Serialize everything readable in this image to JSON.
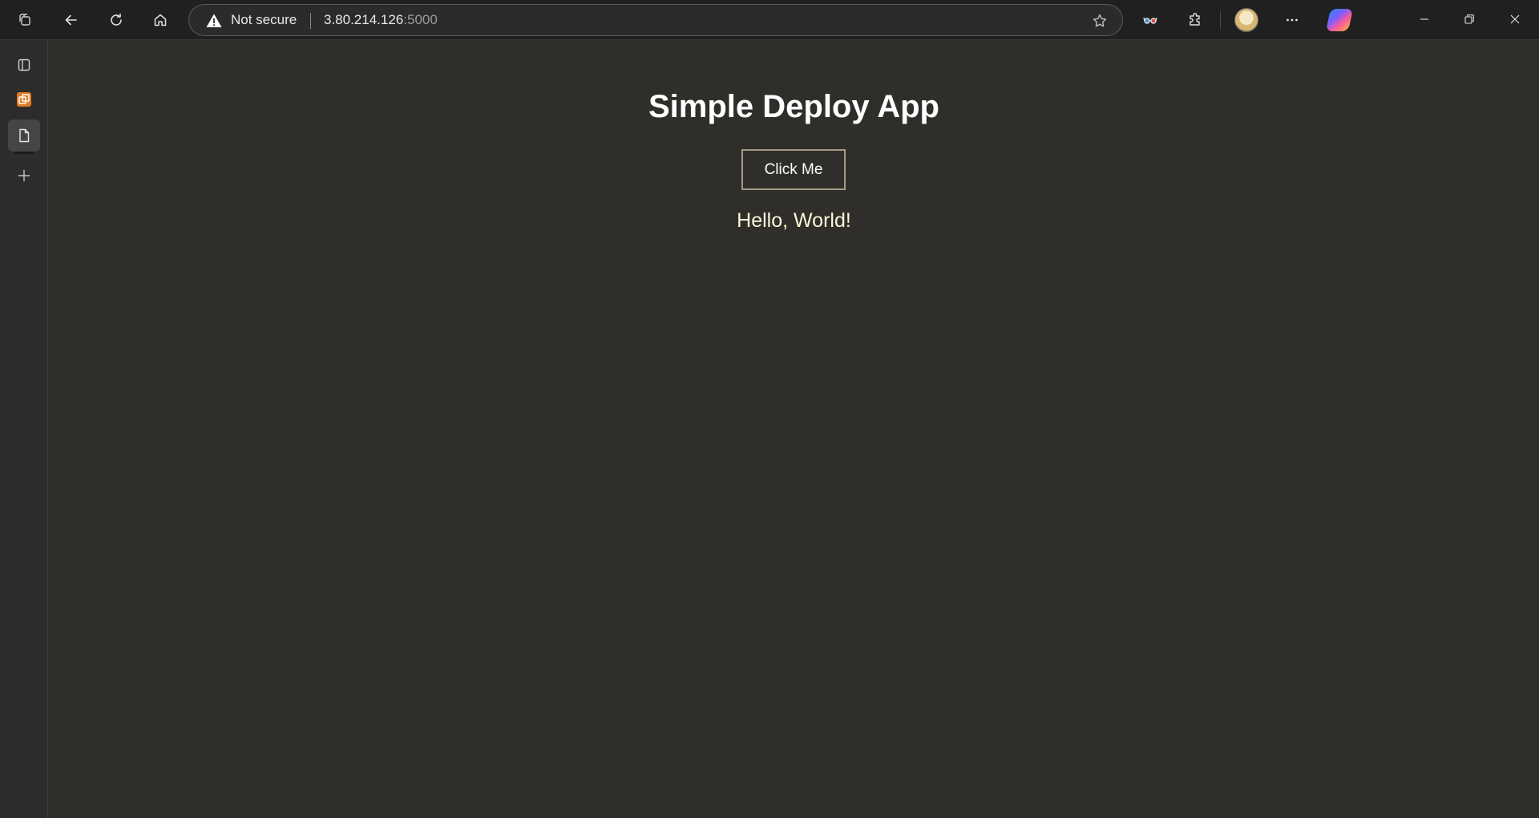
{
  "browser": {
    "address": {
      "security_label": "Not secure",
      "host": "3.80.214.126",
      "port": ":5000"
    },
    "icons": {
      "workspaces": "workspaces-icon",
      "back": "back-arrow-icon",
      "refresh": "refresh-icon",
      "home": "home-icon",
      "warning": "warning-icon",
      "favorite": "star-icon",
      "reading": "glasses-icon",
      "extensions": "puzzle-icon",
      "more": "ellipsis-icon",
      "copilot": "copilot-icon",
      "minimize": "minimize-icon",
      "restore": "restore-icon",
      "close": "close-icon"
    }
  },
  "sidebar": {
    "items": [
      {
        "icon": "tab-panel-icon"
      },
      {
        "icon": "app-tab-icon"
      },
      {
        "icon": "page-tab-icon"
      },
      {
        "icon": "new-tab-plus-icon"
      }
    ]
  },
  "page": {
    "title": "Simple Deploy App",
    "button_label": "Click Me",
    "message": "Hello, World!"
  },
  "colors": {
    "page_background": "#2f2e2a",
    "title": "#ffffff",
    "message": "#fff6d8",
    "button_border": "#a49a86",
    "app_tab_accent": "#e27c22"
  }
}
